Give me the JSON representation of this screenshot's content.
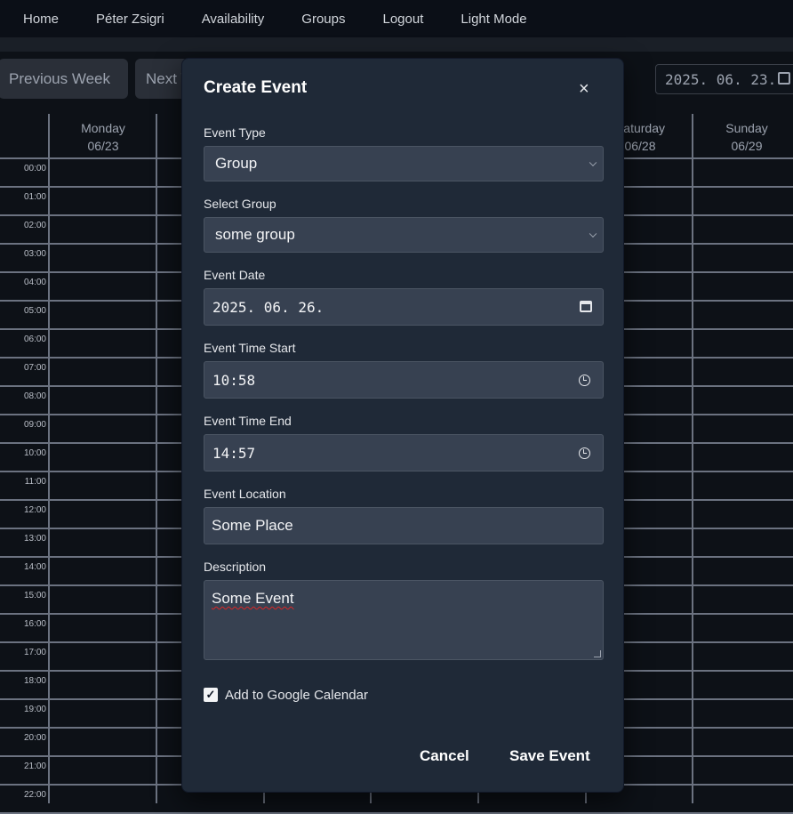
{
  "nav": {
    "items": [
      "Home",
      "Péter Zsigri",
      "Availability",
      "Groups",
      "Logout",
      "Light Mode"
    ]
  },
  "toolbar": {
    "previous_week": "Previous Week",
    "next_week": "Next Week",
    "date_value": "2025. 06. 23."
  },
  "calendar": {
    "days": [
      {
        "name": "Monday",
        "date": "06/23"
      },
      {
        "name": "Saturday",
        "date": "06/28"
      },
      {
        "name": "Sunday",
        "date": "06/29"
      }
    ],
    "hours": [
      "00:00",
      "01:00",
      "02:00",
      "03:00",
      "04:00",
      "05:00",
      "06:00",
      "07:00",
      "08:00",
      "09:00",
      "10:00",
      "11:00",
      "12:00",
      "13:00",
      "14:00",
      "15:00",
      "16:00",
      "17:00",
      "18:00",
      "19:00",
      "20:00",
      "21:00",
      "22:00"
    ]
  },
  "modal": {
    "title": "Create Event",
    "close": "×",
    "event_type_label": "Event Type",
    "event_type_value": "Group",
    "group_label": "Select Group",
    "group_value": "some group",
    "date_label": "Event Date",
    "date_value": "2025. 06. 26.",
    "time_start_label": "Event Time Start",
    "time_start_value": "10:58",
    "time_end_label": "Event Time End",
    "time_end_value": "14:57",
    "location_label": "Event Location",
    "location_value": "Some Place",
    "description_label": "Description",
    "description_value": "Some Event",
    "google_label": "Add to Google Calendar",
    "google_checked": true,
    "cancel": "Cancel",
    "save": "Save Event"
  }
}
